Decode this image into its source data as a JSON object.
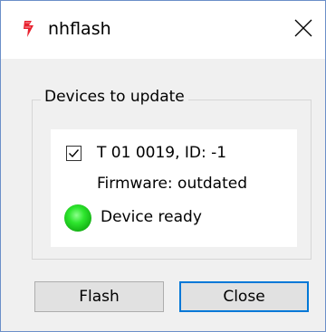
{
  "window": {
    "title": "nhflash",
    "icon": "red-flash-icon",
    "close_icon": "close-icon"
  },
  "group": {
    "label": "Devices to update"
  },
  "device": {
    "checked": true,
    "name": "T 01 0019, ID: -1",
    "firmware": "Firmware: outdated",
    "status": "Device ready",
    "status_color": "#22cc22"
  },
  "buttons": {
    "flash": "Flash",
    "close": "Close"
  }
}
